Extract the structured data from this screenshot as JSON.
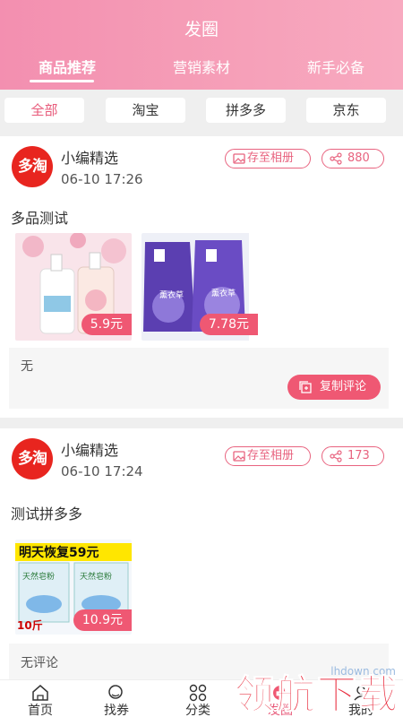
{
  "header": {
    "title": "发圈",
    "tabs": [
      {
        "label": "商品推荐"
      },
      {
        "label": "营销素材"
      },
      {
        "label": "新手必备"
      }
    ]
  },
  "filters": [
    {
      "label": "全部",
      "active": true
    },
    {
      "label": "淘宝"
    },
    {
      "label": "拼多多"
    },
    {
      "label": "京东"
    }
  ],
  "posts": [
    {
      "logo_text": "多淘",
      "author": "小编精选",
      "time": "06-10 17:26",
      "save_label": "存至相册",
      "share_count": "880",
      "text": "多品测试",
      "products": [
        {
          "price": "5.9元",
          "image": "body-wash-bottles"
        },
        {
          "price": "7.78元",
          "image": "laundry-detergent-bags",
          "image_text": "薰衣草"
        }
      ],
      "comment": "无",
      "copy_label": "复制评论"
    },
    {
      "logo_text": "多淘",
      "author": "小编精选",
      "time": "06-10 17:24",
      "save_label": "存至相册",
      "share_count": "173",
      "text": "测试拼多多",
      "products": [
        {
          "price": "10.9元",
          "image": "washing-powder-bags",
          "image_banner": "明天恢复59元",
          "image_side_text": "10斤",
          "image_pack_text": "天然皂粉"
        }
      ],
      "comment": "无评论"
    }
  ],
  "bottom_nav": [
    {
      "label": "首页",
      "icon": "home-icon"
    },
    {
      "label": "找券",
      "icon": "search-icon"
    },
    {
      "label": "分类",
      "icon": "category-icon"
    },
    {
      "label": "发圈",
      "icon": "moments-icon",
      "active": true
    },
    {
      "label": "我的",
      "icon": "profile-icon"
    }
  ],
  "watermark": {
    "text": "领航下载",
    "url": "lhdown.com"
  },
  "colors": {
    "accent": "#ef5873",
    "header_start": "#f38fb0",
    "header_end": "#f8aac0"
  }
}
